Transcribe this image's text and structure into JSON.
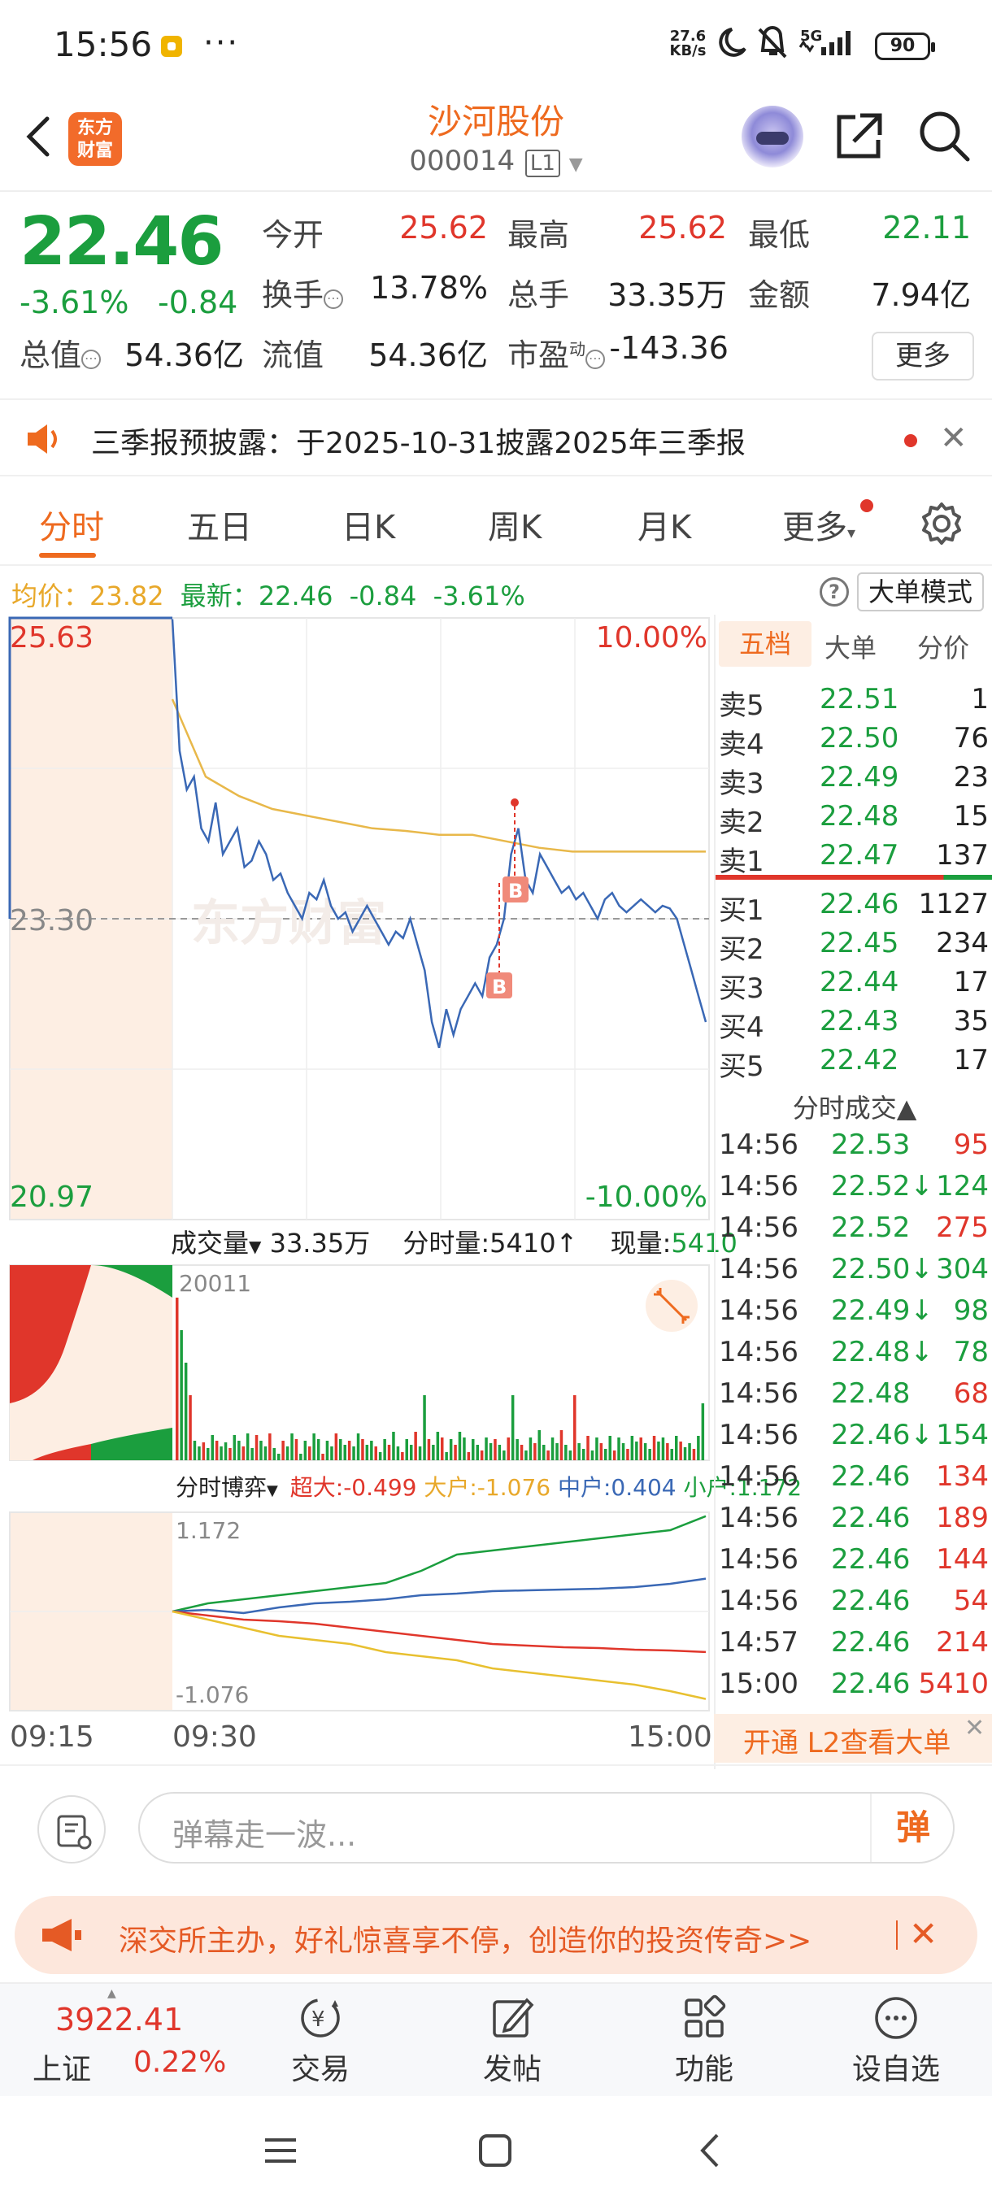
{
  "status_bar": {
    "time": "15:56",
    "dots": "···",
    "net_speed_value": "27.6",
    "net_speed_unit": "KB/s",
    "signal": "5G",
    "battery": "90"
  },
  "header": {
    "logo_line1": "东方",
    "logo_line2": "财富",
    "stock_name": "沙河股份",
    "stock_code": "000014",
    "level_badge": "L1"
  },
  "quote": {
    "price": "22.46",
    "change_pct": "-3.61%",
    "change": "-0.84",
    "open_label": "今开",
    "open": "25.62",
    "high_label": "最高",
    "high": "25.62",
    "low_label": "最低",
    "low": "22.11",
    "turnover_label": "换手",
    "turnover": "13.78%",
    "volume_label": "总手",
    "volume": "33.35万",
    "amount_label": "金额",
    "amount": "7.94亿",
    "mktcap_label": "总值",
    "mktcap": "54.36亿",
    "float_label": "流值",
    "float_cap": "54.36亿",
    "pe_label": "市盈",
    "pe_sup": "动",
    "pe": "-143.36",
    "more_label": "更多"
  },
  "announcement": {
    "text": "三季报预披露：于2025-10-31披露2025年三季报"
  },
  "tabs": [
    {
      "label": "分时"
    },
    {
      "label": "五日"
    },
    {
      "label": "日K"
    },
    {
      "label": "周K"
    },
    {
      "label": "月K"
    },
    {
      "label": "更多"
    }
  ],
  "avg_row": {
    "avg_label": "均价：",
    "avg_value": "23.82",
    "latest_label": "最新：",
    "latest_value": "22.46",
    "change": "-0.84",
    "change_pct": "-3.61%",
    "big_order_mode": "大单模式"
  },
  "price_chart": {
    "top_price": "25.63",
    "mid_price": "23.30",
    "bottom_price": "20.97",
    "top_pct": "10.00%",
    "bottom_pct": "-10.00%",
    "watermark": "东方财富",
    "marker_b": "B"
  },
  "volume_chart": {
    "volume_label": "成交量",
    "total_volume": "33.35万",
    "tick_volume_label": "分时量:5410",
    "tick_volume_arrow": "↑",
    "current_volume_label": "现量:",
    "current_volume": "5410",
    "max_value": "20011"
  },
  "flow_chart": {
    "label": "分时博弈",
    "super_label": "超大:-0.499",
    "large_label": "大户:-1.076",
    "mid_label": "中户:0.404",
    "small_label": "小户:1.172",
    "max_value": "1.172",
    "min_value": "-1.076"
  },
  "time_axis": [
    "09:15",
    "09:30",
    "15:00"
  ],
  "order_book": {
    "tabs": [
      "五档",
      "大单",
      "分价"
    ],
    "asks": [
      {
        "label": "卖5",
        "price": "22.51",
        "vol": "1"
      },
      {
        "label": "卖4",
        "price": "22.50",
        "vol": "76"
      },
      {
        "label": "卖3",
        "price": "22.49",
        "vol": "23"
      },
      {
        "label": "卖2",
        "price": "22.48",
        "vol": "15"
      },
      {
        "label": "卖1",
        "price": "22.47",
        "vol": "137"
      }
    ],
    "bids": [
      {
        "label": "买1",
        "price": "22.46",
        "vol": "1127"
      },
      {
        "label": "买2",
        "price": "22.45",
        "vol": "234"
      },
      {
        "label": "买3",
        "price": "22.44",
        "vol": "17"
      },
      {
        "label": "买4",
        "price": "22.43",
        "vol": "35"
      },
      {
        "label": "买5",
        "price": "22.42",
        "vol": "17"
      }
    ],
    "ticks_header": "分时成交▲",
    "ticks": [
      {
        "time": "14:56",
        "price": "22.53",
        "arrow": "",
        "vol": "95",
        "dir": "up"
      },
      {
        "time": "14:56",
        "price": "22.52",
        "arrow": "↓",
        "vol": "124",
        "dir": "down"
      },
      {
        "time": "14:56",
        "price": "22.52",
        "arrow": "",
        "vol": "275",
        "dir": "up"
      },
      {
        "time": "14:56",
        "price": "22.50",
        "arrow": "↓",
        "vol": "304",
        "dir": "down"
      },
      {
        "time": "14:56",
        "price": "22.49",
        "arrow": "↓",
        "vol": "98",
        "dir": "down"
      },
      {
        "time": "14:56",
        "price": "22.48",
        "arrow": "↓",
        "vol": "78",
        "dir": "down"
      },
      {
        "time": "14:56",
        "price": "22.48",
        "arrow": "",
        "vol": "68",
        "dir": "up"
      },
      {
        "time": "14:56",
        "price": "22.46",
        "arrow": "↓",
        "vol": "154",
        "dir": "down"
      },
      {
        "time": "14:56",
        "price": "22.46",
        "arrow": "",
        "vol": "134",
        "dir": "up"
      },
      {
        "time": "14:56",
        "price": "22.46",
        "arrow": "",
        "vol": "189",
        "dir": "up"
      },
      {
        "time": "14:56",
        "price": "22.46",
        "arrow": "",
        "vol": "144",
        "dir": "up"
      },
      {
        "time": "14:56",
        "price": "22.46",
        "arrow": "",
        "vol": "54",
        "dir": "up"
      },
      {
        "time": "14:57",
        "price": "22.46",
        "arrow": "",
        "vol": "214",
        "dir": "up"
      },
      {
        "time": "15:00",
        "price": "22.46",
        "arrow": "",
        "vol": "5410",
        "dir": "up"
      }
    ],
    "l2_text": "开通 L2查看大单"
  },
  "comment_bar": {
    "placeholder": "弹幕走一波...",
    "danmu_label": "弹"
  },
  "promo": {
    "text": "深交所主办，好礼惊喜享不停，创造你的投资传奇>>"
  },
  "bottom_nav": {
    "index_value": "3922.41",
    "index_name": "上证",
    "index_pct": "0.22%",
    "items": [
      "交易",
      "发帖",
      "功能",
      "设自选"
    ]
  },
  "colors": {
    "accent": "#ee6a1f",
    "up": "#e0362b",
    "down": "#1b9e3e",
    "price_line": "#3a68b5",
    "avg_line": "#e8b84a"
  }
}
